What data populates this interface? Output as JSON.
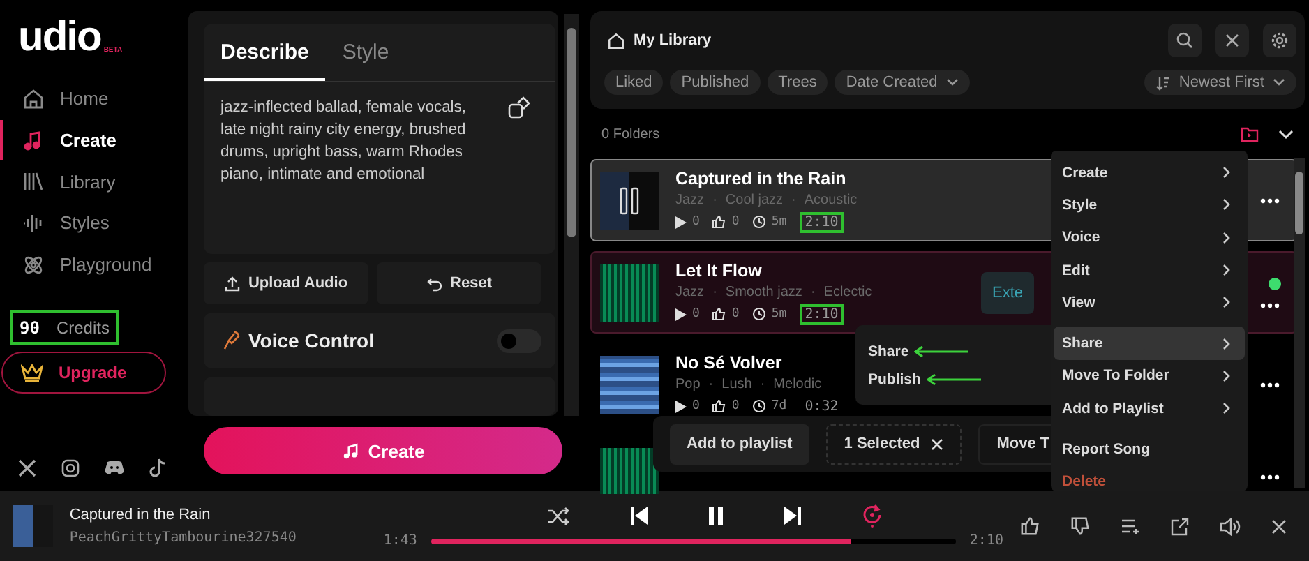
{
  "logo": {
    "text": "udio",
    "badge": "BETA"
  },
  "nav": [
    {
      "label": "Home",
      "selected": false
    },
    {
      "label": "Create",
      "selected": true
    },
    {
      "label": "Library",
      "selected": false
    },
    {
      "label": "Styles",
      "selected": false
    },
    {
      "label": "Playground",
      "selected": false
    }
  ],
  "credits": {
    "count": "90",
    "label": "Credits",
    "highlighted": true
  },
  "upgrade": "Upgrade",
  "create": {
    "tabs": [
      {
        "label": "Describe",
        "selected": true
      },
      {
        "label": "Style",
        "selected": false
      }
    ],
    "prompt": "jazz-inflected ballad, female vocals, late night rainy city energy, brushed drums, upright bass, warm Rhodes piano, intimate and emotional",
    "upload": "Upload Audio",
    "reset": "Reset",
    "voice": {
      "label": "Voice Control",
      "on": false
    },
    "button": "Create"
  },
  "library": {
    "title": "My Library",
    "filters": [
      "Liked",
      "Published",
      "Trees"
    ],
    "tag_separator": "·",
    "date_filter": "Date Created",
    "sort": "Newest First",
    "folders": "0 Folders",
    "tracks": [
      {
        "title": "Captured in the Rain",
        "tags": [
          "Jazz",
          "Cool jazz",
          "Acoustic"
        ],
        "plays": "0",
        "likes": "0",
        "age": "5m",
        "duration": "2:10",
        "duration_highlighted": true,
        "playing": true,
        "selected": false,
        "status_dot": false,
        "kind": "dark"
      },
      {
        "title": "Let It Flow",
        "tags": [
          "Jazz",
          "Smooth jazz",
          "Eclectic"
        ],
        "plays": "0",
        "likes": "0",
        "age": "5m",
        "duration": "2:10",
        "duration_highlighted": true,
        "playing": false,
        "selected": true,
        "status_dot": true,
        "action": "Exte",
        "kind": "grid"
      },
      {
        "title": "No Sé Volver",
        "tags": [
          "Pop",
          "Lush",
          "Melodic"
        ],
        "plays": "0",
        "likes": "0",
        "age": "7d",
        "duration": "0:32",
        "duration_highlighted": false,
        "playing": false,
        "selected": false,
        "kind": "blue"
      },
      {
        "playing": false,
        "selected": false,
        "kind": "grid"
      }
    ]
  },
  "context_menu": [
    {
      "label": "Create",
      "submenu": true,
      "hover": false,
      "danger": false,
      "group_start": false
    },
    {
      "label": "Style",
      "submenu": true,
      "hover": false,
      "danger": false,
      "group_start": false
    },
    {
      "label": "Voice",
      "submenu": true,
      "hover": false,
      "danger": false,
      "group_start": false
    },
    {
      "label": "Edit",
      "submenu": true,
      "hover": false,
      "danger": false,
      "group_start": false
    },
    {
      "label": "View",
      "submenu": true,
      "hover": false,
      "danger": false,
      "group_start": false
    },
    {
      "label": "Share",
      "submenu": true,
      "hover": true,
      "danger": false,
      "group_start": true
    },
    {
      "label": "Move To Folder",
      "submenu": true,
      "hover": false,
      "danger": false,
      "group_start": false
    },
    {
      "label": "Add to Playlist",
      "submenu": true,
      "hover": false,
      "danger": false,
      "group_start": false
    },
    {
      "label": "Report Song",
      "submenu": false,
      "hover": false,
      "danger": false,
      "group_start": true
    },
    {
      "label": "Delete",
      "submenu": false,
      "hover": false,
      "danger": true,
      "group_start": false
    }
  ],
  "share_menu": [
    {
      "label": "Share",
      "annotated": true
    },
    {
      "label": "Publish",
      "annotated": true
    }
  ],
  "action_bar": {
    "add": "Add to playlist",
    "selected": "1 Selected",
    "move": "Move T"
  },
  "player": {
    "title": "Captured in the Rain",
    "artist": "PeachGrittyTambourine327540",
    "elapsed": "1:43",
    "total": "2:10",
    "level": 0.8,
    "playing": true,
    "repeat_on": true
  }
}
